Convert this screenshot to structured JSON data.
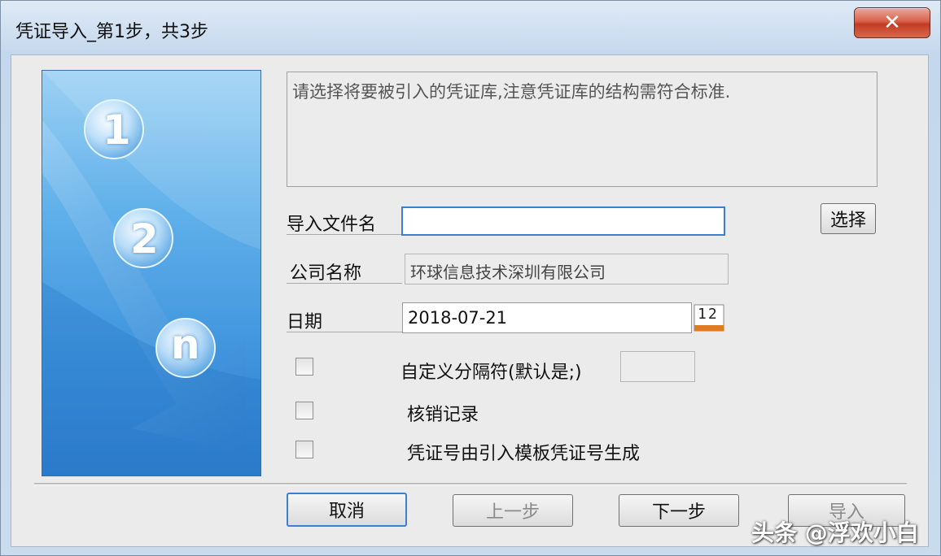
{
  "window": {
    "title": "凭证导入_第1步，共3步",
    "close_glyph": "✕"
  },
  "wizard_art": {
    "steps": [
      "1",
      "2",
      "n"
    ]
  },
  "description": "请选择将要被引入的凭证库,注意凭证库的结构需符合标准.",
  "form": {
    "file_label": "导入文件名",
    "file_value": "",
    "select_button": "选择",
    "company_label": "公司名称",
    "company_value": "环球信息技术深圳有限公司",
    "date_label": "日期",
    "date_value": "2018-07-21",
    "calendar_icon_text": "12"
  },
  "options": [
    {
      "label": "自定义分隔符(默认是;)",
      "checked": false
    },
    {
      "label": "核销记录",
      "checked": false
    },
    {
      "label": "凭证号由引入模板凭证号生成",
      "checked": false
    }
  ],
  "buttons": {
    "cancel": "取消",
    "prev": "上一步",
    "next": "下一步",
    "import": "导入"
  },
  "watermark": "头条 @浮欢小白"
}
